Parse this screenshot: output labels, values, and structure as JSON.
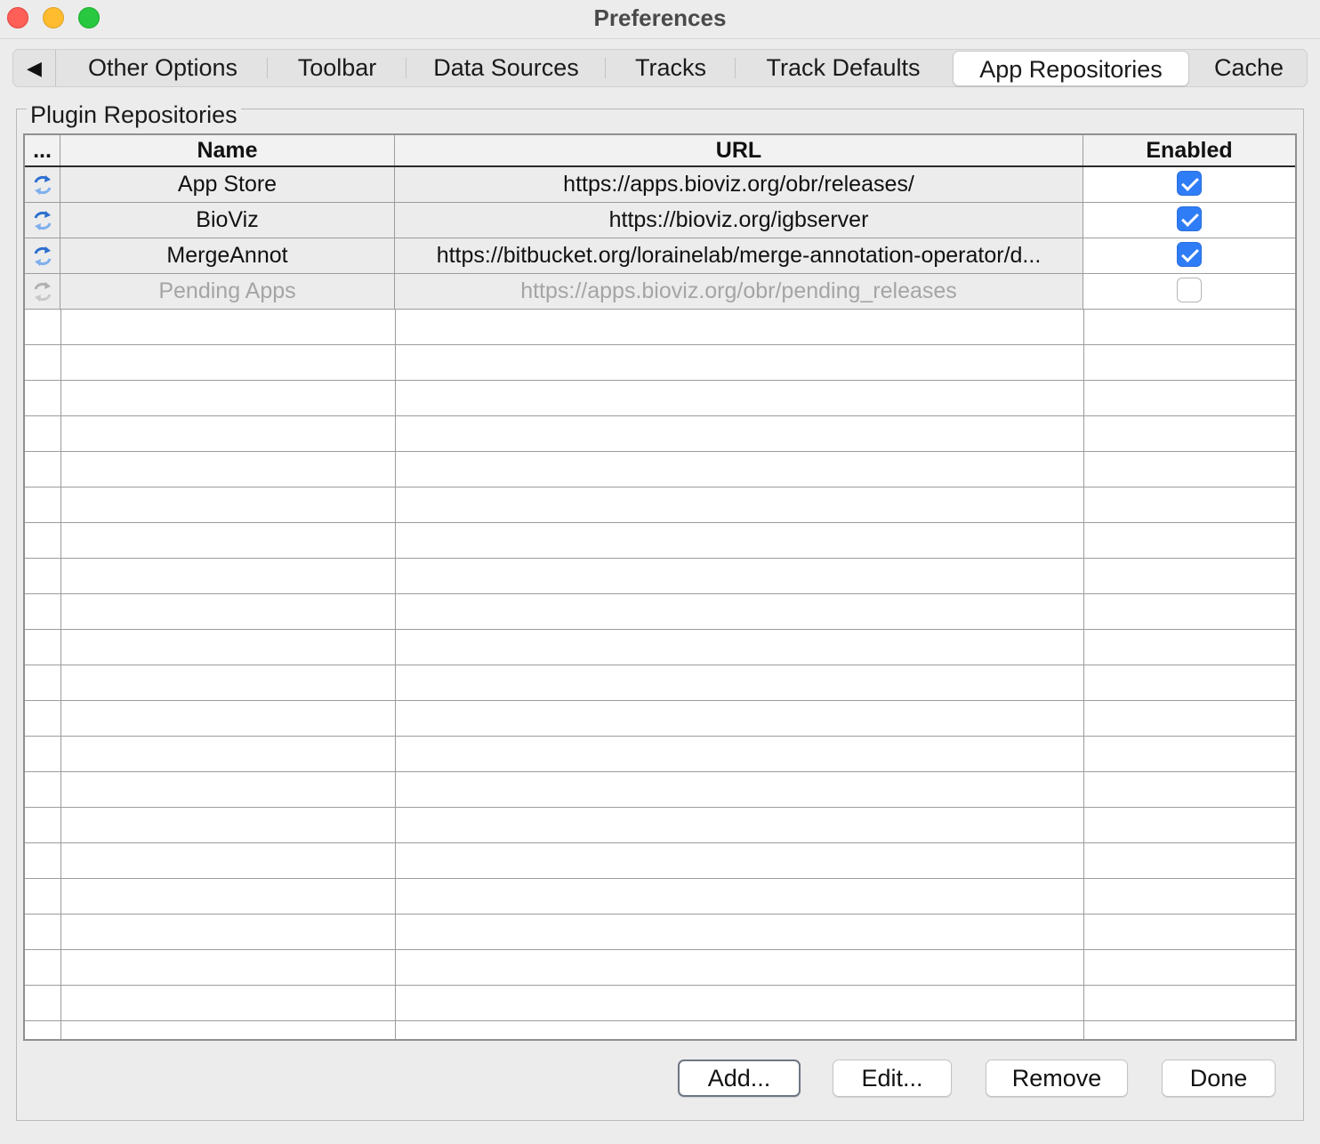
{
  "window": {
    "title": "Preferences"
  },
  "tabs": {
    "scroll_left": "◀",
    "items": [
      {
        "label": "Other Options"
      },
      {
        "label": "Toolbar"
      },
      {
        "label": "Data Sources"
      },
      {
        "label": "Tracks"
      },
      {
        "label": "Track Defaults"
      },
      {
        "label": "App Repositories",
        "active": true
      },
      {
        "label": "Cache"
      }
    ]
  },
  "group": {
    "title": "Plugin Repositories"
  },
  "table": {
    "headers": [
      "...",
      "Name",
      "URL",
      "Enabled"
    ],
    "rows": [
      {
        "icon": "refresh-icon",
        "name": "App Store",
        "url": "https://apps.bioviz.org/obr/releases/",
        "enabled": true
      },
      {
        "icon": "refresh-icon",
        "name": "BioViz",
        "url": "https://bioviz.org/igbserver",
        "enabled": true
      },
      {
        "icon": "refresh-icon",
        "name": "MergeAnnot",
        "url": "https://bitbucket.org/lorainelab/merge-annotation-operator/d...",
        "enabled": true
      },
      {
        "icon": "refresh-icon",
        "name": "Pending Apps",
        "url": "https://apps.bioviz.org/obr/pending_releases",
        "enabled": false,
        "disabled": true
      }
    ]
  },
  "buttons": {
    "add": "Add...",
    "edit": "Edit...",
    "remove": "Remove",
    "done": "Done"
  },
  "colors": {
    "checkbox_accent": "#2f7df6",
    "close": "#fe5f57",
    "minimize": "#febc2e",
    "maximize": "#28c840"
  }
}
